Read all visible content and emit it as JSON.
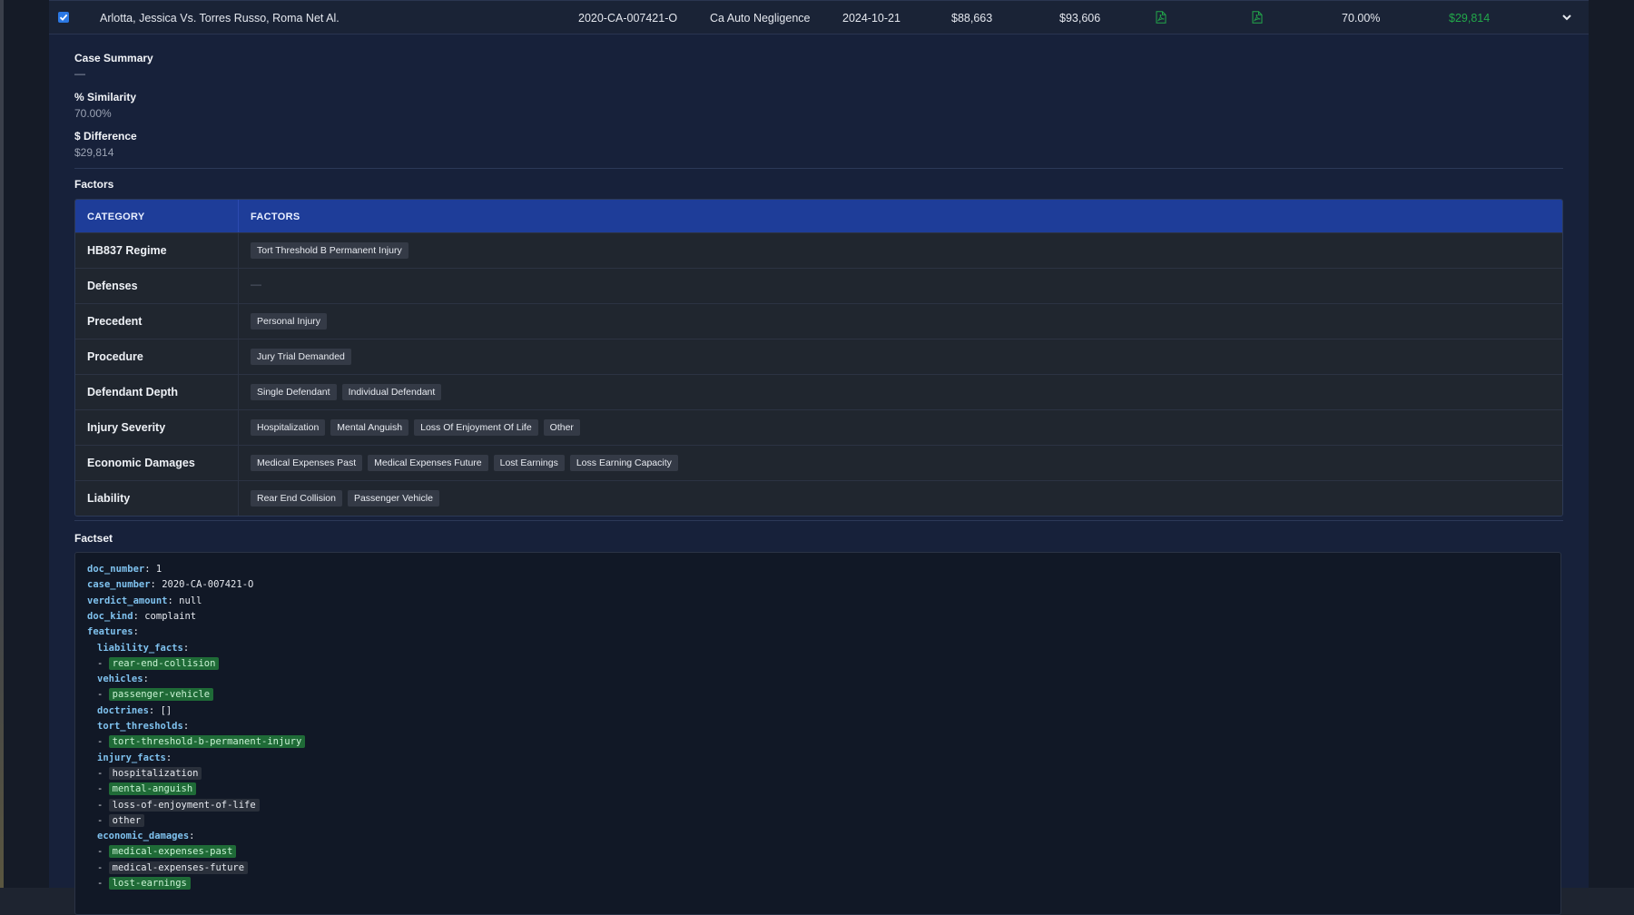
{
  "case_row": {
    "checked": true,
    "title": "Arlotta, Jessica Vs. Torres Russo, Roma Net Al.",
    "case_number": "2020-CA-007421-O",
    "case_type": "Ca Auto Negligence",
    "date": "2024-10-21",
    "amount_1": "$88,663",
    "amount_2": "$93,606",
    "pdf_icon_1": "pdf-icon",
    "pdf_icon_2": "pdf-icon",
    "similarity": "70.00%",
    "difference": "$29,814",
    "expand_icon": "chevron-down-icon"
  },
  "summary": {
    "case_summary_label": "Case Summary",
    "case_summary_value": "—",
    "similarity_label": "% Similarity",
    "similarity_value": "70.00%",
    "difference_label": "$ Difference",
    "difference_value": "$29,814"
  },
  "factors": {
    "heading": "Factors",
    "columns": [
      "CATEGORY",
      "FACTORS"
    ],
    "rows": [
      {
        "category": "HB837 Regime",
        "tags": [
          "Tort Threshold B Permanent Injury"
        ]
      },
      {
        "category": "Defenses",
        "tags": []
      },
      {
        "category": "Precedent",
        "tags": [
          "Personal Injury"
        ]
      },
      {
        "category": "Procedure",
        "tags": [
          "Jury Trial Demanded"
        ]
      },
      {
        "category": "Defendant Depth",
        "tags": [
          "Single Defendant",
          "Individual Defendant"
        ]
      },
      {
        "category": "Injury Severity",
        "tags": [
          "Hospitalization",
          "Mental Anguish",
          "Loss Of Enjoyment Of Life",
          "Other"
        ]
      },
      {
        "category": "Economic Damages",
        "tags": [
          "Medical Expenses Past",
          "Medical Expenses Future",
          "Lost Earnings",
          "Loss Earning Capacity"
        ]
      },
      {
        "category": "Liability",
        "tags": [
          "Rear End Collision",
          "Passenger Vehicle"
        ]
      }
    ],
    "empty_value": "—"
  },
  "factset": {
    "heading": "Factset",
    "lines": [
      {
        "indent": 0,
        "key": "doc_number",
        "value": "1"
      },
      {
        "indent": 0,
        "key": "case_number",
        "value": "2020-CA-007421-O"
      },
      {
        "indent": 0,
        "key": "verdict_amount",
        "value": "null"
      },
      {
        "indent": 0,
        "key": "doc_kind",
        "value": "complaint"
      },
      {
        "indent": 0,
        "key": "features",
        "value": ""
      },
      {
        "indent": 1,
        "key": "liability_facts",
        "value": ""
      },
      {
        "indent": 1,
        "item": "rear-end-collision",
        "match": true
      },
      {
        "indent": 1,
        "key": "vehicles",
        "value": ""
      },
      {
        "indent": 1,
        "item": "passenger-vehicle",
        "match": true
      },
      {
        "indent": 1,
        "key": "doctrines",
        "value": "[]"
      },
      {
        "indent": 1,
        "key": "tort_thresholds",
        "value": ""
      },
      {
        "indent": 1,
        "item": "tort-threshold-b-permanent-injury",
        "match": true
      },
      {
        "indent": 1,
        "key": "injury_facts",
        "value": ""
      },
      {
        "indent": 1,
        "item": "hospitalization",
        "match": false
      },
      {
        "indent": 1,
        "item": "mental-anguish",
        "match": true
      },
      {
        "indent": 1,
        "item": "loss-of-enjoyment-of-life",
        "match": false
      },
      {
        "indent": 1,
        "item": "other",
        "match": false
      },
      {
        "indent": 1,
        "key": "economic_damages",
        "value": ""
      },
      {
        "indent": 1,
        "item": "medical-expenses-past",
        "match": true
      },
      {
        "indent": 1,
        "item": "medical-expenses-future",
        "match": false
      },
      {
        "indent": 1,
        "item": "lost-earnings",
        "match": true
      }
    ]
  },
  "colors": {
    "accent_header": "#1e3d99",
    "positive": "#22a84a",
    "match_chip": "#1f6b37"
  }
}
